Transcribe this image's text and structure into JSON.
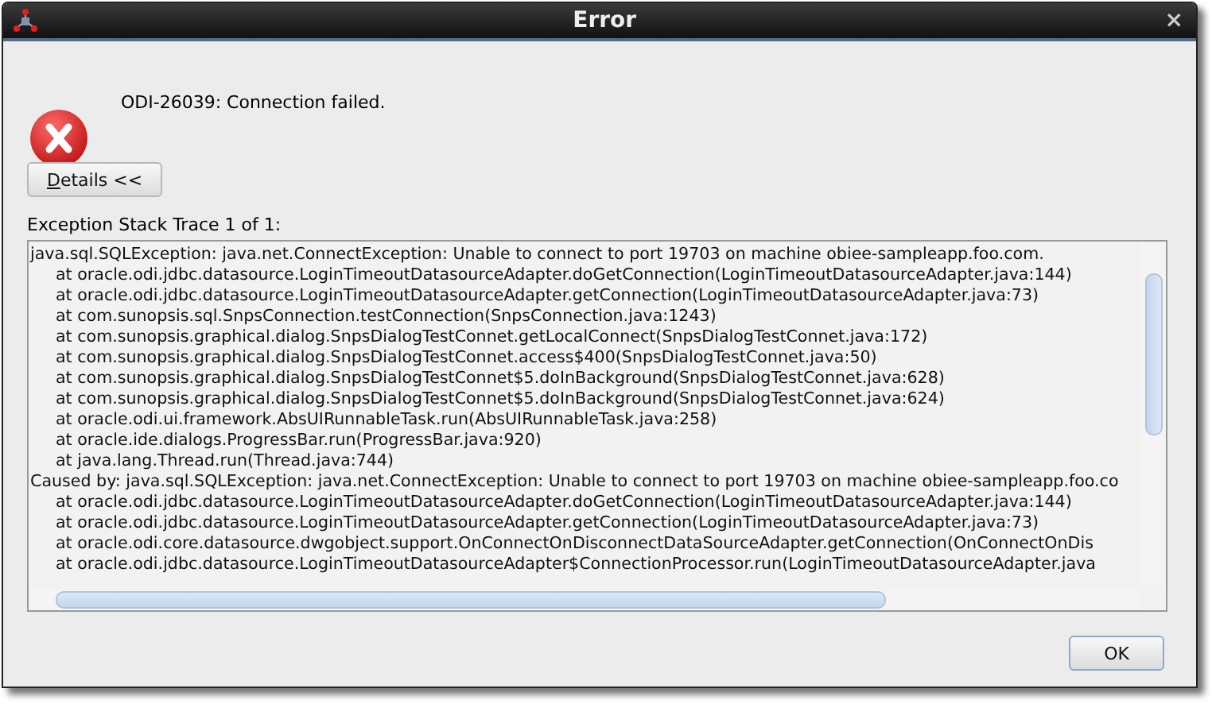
{
  "window": {
    "title": "Error",
    "close": "×"
  },
  "message": "ODI-26039: Connection failed.",
  "details_button": {
    "label": "Details <<"
  },
  "trace_label": "Exception Stack Trace 1 of 1:",
  "trace_lines": [
    {
      "kind": "exception",
      "text": "java.sql.SQLException: java.net.ConnectException: Unable to connect to port 19703 on machine obiee-sampleapp.foo.com."
    },
    {
      "kind": "frame",
      "text": "at oracle.odi.jdbc.datasource.LoginTimeoutDatasourceAdapter.doGetConnection(LoginTimeoutDatasourceAdapter.java:144)"
    },
    {
      "kind": "frame",
      "text": "at oracle.odi.jdbc.datasource.LoginTimeoutDatasourceAdapter.getConnection(LoginTimeoutDatasourceAdapter.java:73)"
    },
    {
      "kind": "frame",
      "text": "at com.sunopsis.sql.SnpsConnection.testConnection(SnpsConnection.java:1243)"
    },
    {
      "kind": "frame",
      "text": "at com.sunopsis.graphical.dialog.SnpsDialogTestConnet.getLocalConnect(SnpsDialogTestConnet.java:172)"
    },
    {
      "kind": "frame",
      "text": "at com.sunopsis.graphical.dialog.SnpsDialogTestConnet.access$400(SnpsDialogTestConnet.java:50)"
    },
    {
      "kind": "frame",
      "text": "at com.sunopsis.graphical.dialog.SnpsDialogTestConnet$5.doInBackground(SnpsDialogTestConnet.java:628)"
    },
    {
      "kind": "frame",
      "text": "at com.sunopsis.graphical.dialog.SnpsDialogTestConnet$5.doInBackground(SnpsDialogTestConnet.java:624)"
    },
    {
      "kind": "frame",
      "text": "at oracle.odi.ui.framework.AbsUIRunnableTask.run(AbsUIRunnableTask.java:258)"
    },
    {
      "kind": "frame",
      "text": "at oracle.ide.dialogs.ProgressBar.run(ProgressBar.java:920)"
    },
    {
      "kind": "frame",
      "text": "at java.lang.Thread.run(Thread.java:744)"
    },
    {
      "kind": "exception",
      "text": "Caused by: java.sql.SQLException: java.net.ConnectException: Unable to connect to port 19703 on machine obiee-sampleapp.foo.co"
    },
    {
      "kind": "frame",
      "text": "at oracle.odi.jdbc.datasource.LoginTimeoutDatasourceAdapter.doGetConnection(LoginTimeoutDatasourceAdapter.java:144)"
    },
    {
      "kind": "frame",
      "text": "at oracle.odi.jdbc.datasource.LoginTimeoutDatasourceAdapter.getConnection(LoginTimeoutDatasourceAdapter.java:73)"
    },
    {
      "kind": "frame",
      "text": "at oracle.odi.core.datasource.dwgobject.support.OnConnectOnDisconnectDataSourceAdapter.getConnection(OnConnectOnDis"
    },
    {
      "kind": "frame",
      "text": "at oracle.odi.jdbc.datasource.LoginTimeoutDatasourceAdapter$ConnectionProcessor.run(LoginTimeoutDatasourceAdapter.java"
    }
  ],
  "ok_button": "OK"
}
